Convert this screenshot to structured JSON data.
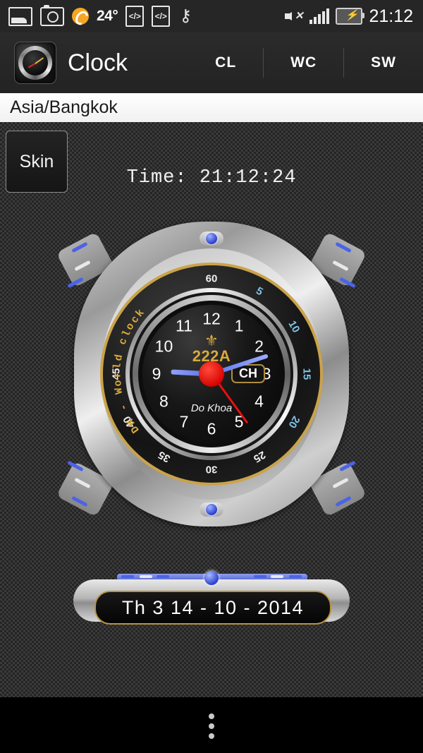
{
  "status_bar": {
    "temperature": "24°",
    "clock": "21:12",
    "icons_left": [
      "image-icon",
      "camera-icon",
      "sync-icon",
      "code-icon",
      "code-icon",
      "usb-icon"
    ],
    "icons_right": [
      "mute-icon",
      "signal-icon",
      "battery-charging-icon"
    ],
    "code_label": "</>"
  },
  "action_bar": {
    "app_name": "Clock",
    "tabs": [
      {
        "label": "CL"
      },
      {
        "label": "WC"
      },
      {
        "label": "SW"
      }
    ]
  },
  "timezone_bar": {
    "value": "Asia/Bangkok"
  },
  "content": {
    "skin_button": "Skin",
    "time_label": "Time:  21:12:24"
  },
  "watch": {
    "bezel_text": "DK - World clock",
    "bezel_minutes": [
      {
        "value": "60",
        "angle": 0,
        "color": "white"
      },
      {
        "value": "5",
        "angle": 30,
        "color": "cyan"
      },
      {
        "value": "10",
        "angle": 60,
        "color": "cyan"
      },
      {
        "value": "15",
        "angle": 90,
        "color": "cyan"
      },
      {
        "value": "20",
        "angle": 120,
        "color": "cyan"
      },
      {
        "value": "25",
        "angle": 150,
        "color": "white"
      },
      {
        "value": "30",
        "angle": 180,
        "color": "white"
      },
      {
        "value": "35",
        "angle": 210,
        "color": "white"
      },
      {
        "value": "40",
        "angle": 240,
        "color": "white"
      },
      {
        "value": "45",
        "angle": 270,
        "color": "white"
      }
    ],
    "hour_numerals": [
      "12",
      "1",
      "2",
      "3",
      "4",
      "5",
      "6",
      "7",
      "8",
      "9",
      "10",
      "11"
    ],
    "brand_symbol": "⚜",
    "brand_text": "222A",
    "signature": "Do Khoa",
    "ampm_indicator": "CH",
    "hands": {
      "hour_angle": 273,
      "minute_angle": 72,
      "second_angle": 144
    },
    "colors": {
      "gold": "#d9a93c",
      "hand_blue": "#6076ee",
      "hand_red": "#e81010",
      "bezel_cyan": "#7fc4e8"
    }
  },
  "date_plate": {
    "text": "Th 3   14 - 10 - 2014"
  },
  "nav_bar": {
    "overflow": "overflow-menu"
  }
}
